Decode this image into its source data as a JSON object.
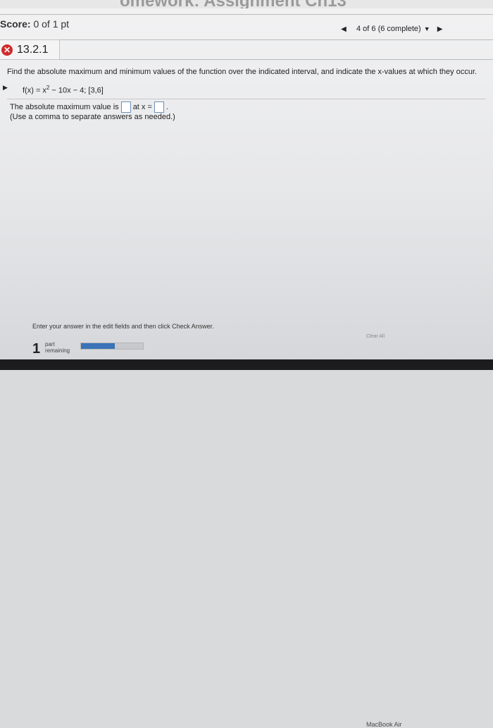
{
  "window": {
    "title": "omework: Assignment Ch13"
  },
  "score": {
    "label": "Score:",
    "value": "0 of 1 pt"
  },
  "nav": {
    "progress": "4 of 6 (6 complete)",
    "caret": "▼",
    "prev": "◀",
    "next": "▶"
  },
  "question": {
    "number": "13.2.1",
    "status_icon": "x-icon",
    "instruction": "Find the absolute maximum and minimum values of the function over the indicated interval, and indicate the x-values at which they occur.",
    "function_pre": "f(x) = x",
    "function_exp": "2",
    "function_post": " − 10x − 4;  [3,6]",
    "answer_prefix": "The absolute maximum value is",
    "answer_mid": "at x =",
    "answer_suffix": ".",
    "hint": "(Use a comma to separate answers as needed.)",
    "max_value": "",
    "max_x": ""
  },
  "footer": {
    "instruction": "Enter your answer in the edit fields and then click Check Answer.",
    "clear_all_label": "Clear All",
    "parts_remaining_count": "1",
    "parts_remaining_label": "part remaining",
    "progress_fraction": 0.55
  },
  "device": {
    "brand": "MacBook Air"
  }
}
